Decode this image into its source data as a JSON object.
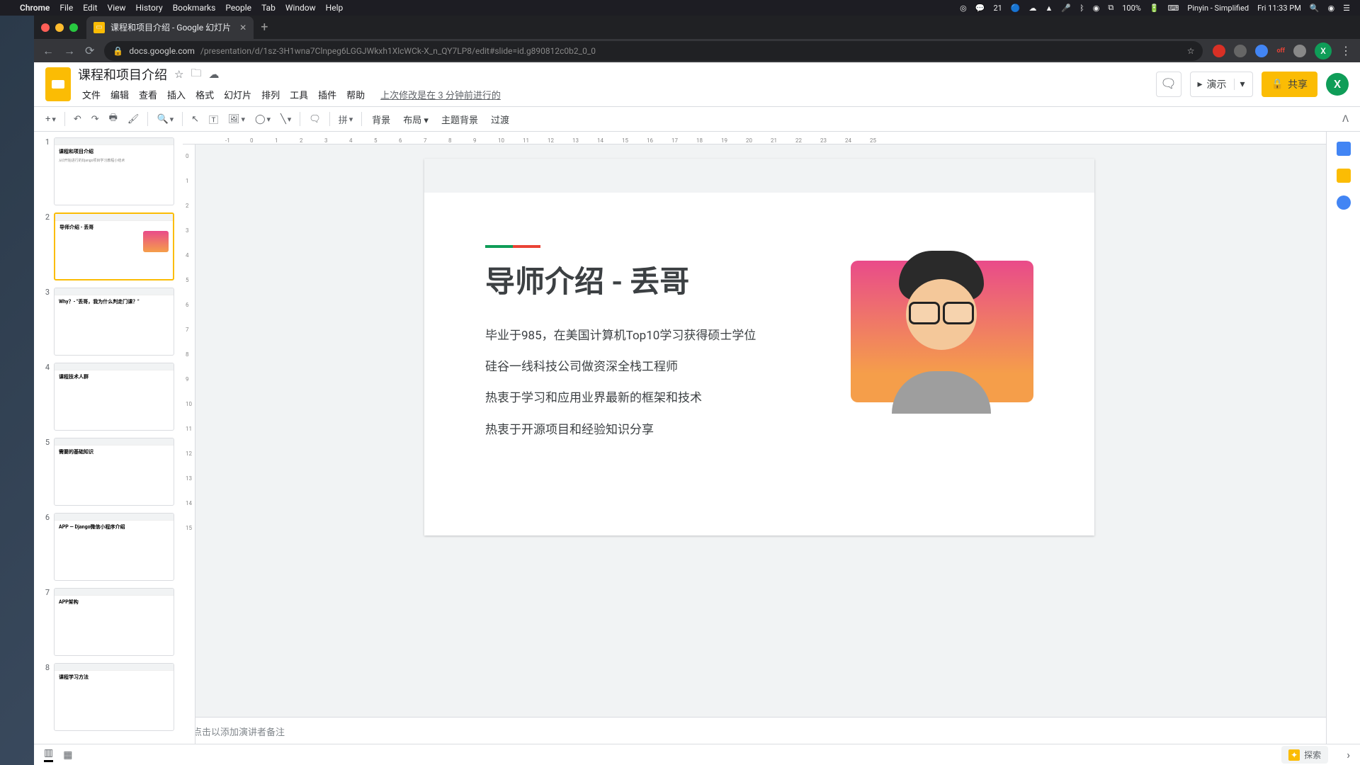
{
  "mac_menu": {
    "app": "Chrome",
    "items": [
      "File",
      "Edit",
      "View",
      "History",
      "Bookmarks",
      "People",
      "Tab",
      "Window",
      "Help"
    ],
    "right": {
      "count": "21",
      "battery": "100%",
      "ime": "Pinyin - Simplified",
      "clock": "Fri 11:33 PM"
    }
  },
  "chrome": {
    "tab_title": "课程和项目介绍 - Google 幻灯片",
    "url_host": "docs.google.com",
    "url_path": "/presentation/d/1sz-3H1wna7Clnpeg6LGGJWkxh1XlcWCk-X_n_QY7LP8/edit#slide=id.g890812c0b2_0_0"
  },
  "slides": {
    "doc_title": "课程和项目介绍",
    "menus": [
      "文件",
      "编辑",
      "查看",
      "插入",
      "格式",
      "幻灯片",
      "排列",
      "工具",
      "插件",
      "帮助"
    ],
    "last_edit": "上次修改是在 3 分钟前进行的",
    "present": "演示",
    "share": "共享",
    "toolbar": {
      "bg": "背景",
      "layout": "布局",
      "theme": "主题背景",
      "transition": "过渡",
      "pinyin": "拼"
    },
    "speaker_placeholder": "点击以添加演讲者备注",
    "explore": "探索"
  },
  "current_slide": {
    "title": "导师介绍 - 丢哥",
    "bullets": [
      "毕业于985，在美国计算机Top10学习获得硕士学位",
      "硅谷一线科技公司做资深全栈工程师",
      "热衷于学习和应用业界最新的框架和技术",
      "热衷于开源项目和经验知识分享"
    ]
  },
  "thumbnails": [
    {
      "n": "1",
      "title": "课程和项目介绍",
      "sub": "从0开始进行的Django项目学习教程小结术"
    },
    {
      "n": "2",
      "title": "导师介绍 - 丢哥",
      "sub": ""
    },
    {
      "n": "3",
      "title": "Why？- \"丢哥，我为什么判走门课？\"",
      "sub": ""
    },
    {
      "n": "4",
      "title": "课程技术人群",
      "sub": ""
    },
    {
      "n": "5",
      "title": "需要的基础知识",
      "sub": ""
    },
    {
      "n": "6",
      "title": "APP — Django微信小程序介绍",
      "sub": ""
    },
    {
      "n": "7",
      "title": "APP架构",
      "sub": ""
    },
    {
      "n": "8",
      "title": "课程学习方法",
      "sub": ""
    }
  ],
  "ruler_h": [
    -1,
    0,
    1,
    2,
    3,
    4,
    5,
    6,
    7,
    8,
    9,
    10,
    11,
    12,
    13,
    14,
    15,
    16,
    17,
    18,
    19,
    20,
    21,
    22,
    23,
    24,
    25
  ],
  "ruler_v": [
    0,
    1,
    2,
    3,
    4,
    5,
    6,
    7,
    8,
    9,
    10,
    11,
    12,
    13,
    14,
    15
  ]
}
